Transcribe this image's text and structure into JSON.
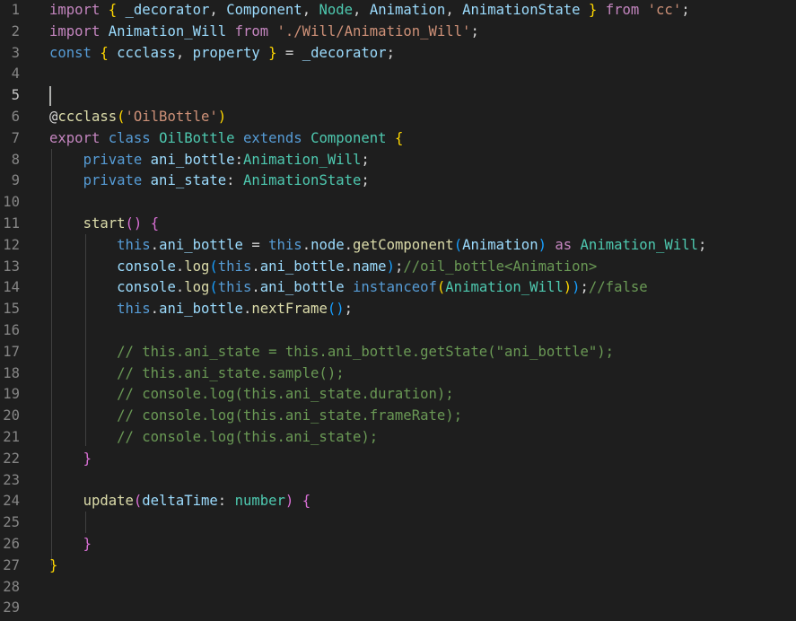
{
  "editor": {
    "active_line": 5,
    "colors": {
      "background": "#1e1e1e",
      "line_number": "#858585",
      "line_number_active": "#c6c6c6",
      "keyword_control": "#c586c0",
      "keyword_storage": "#569cd6",
      "variable": "#9cdcfe",
      "type": "#4ec9b0",
      "function": "#dcdcaa",
      "string": "#ce9178",
      "comment": "#6a9955",
      "punctuation": "#d4d4d4",
      "bracket_1": "#ffd700",
      "bracket_2": "#da70d6",
      "bracket_3": "#179fff"
    },
    "lines": [
      {
        "n": "1",
        "tokens": [
          [
            "import",
            "kw"
          ],
          [
            " ",
            "p"
          ],
          [
            "{",
            "b1"
          ],
          [
            " _decorator",
            "v"
          ],
          [
            ", ",
            "p"
          ],
          [
            "Component",
            "v"
          ],
          [
            ", ",
            "p"
          ],
          [
            "Node",
            "t"
          ],
          [
            ", ",
            "p"
          ],
          [
            "Animation",
            "v"
          ],
          [
            ", ",
            "p"
          ],
          [
            "AnimationState",
            "v"
          ],
          [
            " ",
            "p"
          ],
          [
            "}",
            "b1"
          ],
          [
            " ",
            "p"
          ],
          [
            "from",
            "kw"
          ],
          [
            " ",
            "p"
          ],
          [
            "'cc'",
            "s"
          ],
          [
            ";",
            "p"
          ]
        ]
      },
      {
        "n": "2",
        "tokens": [
          [
            "import",
            "kw"
          ],
          [
            " ",
            "p"
          ],
          [
            "Animation_Will",
            "v"
          ],
          [
            " ",
            "p"
          ],
          [
            "from",
            "kw"
          ],
          [
            " ",
            "p"
          ],
          [
            "'./Will/Animation_Will'",
            "s"
          ],
          [
            ";",
            "p"
          ]
        ]
      },
      {
        "n": "3",
        "tokens": [
          [
            "const",
            "st"
          ],
          [
            " ",
            "p"
          ],
          [
            "{",
            "b1"
          ],
          [
            " ccclass",
            "v"
          ],
          [
            ", ",
            "p"
          ],
          [
            "property",
            "v"
          ],
          [
            " ",
            "p"
          ],
          [
            "}",
            "b1"
          ],
          [
            " = ",
            "p"
          ],
          [
            "_decorator",
            "v"
          ],
          [
            ";",
            "p"
          ]
        ]
      },
      {
        "n": "4",
        "tokens": []
      },
      {
        "n": "5",
        "tokens": []
      },
      {
        "n": "6",
        "tokens": [
          [
            "@",
            "p"
          ],
          [
            "ccclass",
            "f"
          ],
          [
            "(",
            "b1"
          ],
          [
            "'OilBottle'",
            "s"
          ],
          [
            ")",
            "b1"
          ]
        ]
      },
      {
        "n": "7",
        "tokens": [
          [
            "export",
            "kw"
          ],
          [
            " ",
            "p"
          ],
          [
            "class",
            "st"
          ],
          [
            " ",
            "p"
          ],
          [
            "OilBottle",
            "t"
          ],
          [
            " ",
            "p"
          ],
          [
            "extends",
            "st"
          ],
          [
            " ",
            "p"
          ],
          [
            "Component",
            "t"
          ],
          [
            " ",
            "p"
          ],
          [
            "{",
            "b1"
          ]
        ]
      },
      {
        "n": "8",
        "tokens": [
          [
            "    ",
            "p"
          ],
          [
            "private",
            "st"
          ],
          [
            " ",
            "p"
          ],
          [
            "ani_bottle",
            "v"
          ],
          [
            ":",
            "p"
          ],
          [
            "Animation_Will",
            "t"
          ],
          [
            ";",
            "p"
          ]
        ]
      },
      {
        "n": "9",
        "tokens": [
          [
            "    ",
            "p"
          ],
          [
            "private",
            "st"
          ],
          [
            " ",
            "p"
          ],
          [
            "ani_state",
            "v"
          ],
          [
            ": ",
            "p"
          ],
          [
            "AnimationState",
            "t"
          ],
          [
            ";",
            "p"
          ]
        ]
      },
      {
        "n": "10",
        "tokens": []
      },
      {
        "n": "11",
        "tokens": [
          [
            "    ",
            "p"
          ],
          [
            "start",
            "f"
          ],
          [
            "()",
            "b2"
          ],
          [
            " ",
            "p"
          ],
          [
            "{",
            "b2"
          ]
        ]
      },
      {
        "n": "12",
        "tokens": [
          [
            "        ",
            "p"
          ],
          [
            "this",
            "st"
          ],
          [
            ".",
            "p"
          ],
          [
            "ani_bottle",
            "v"
          ],
          [
            " = ",
            "p"
          ],
          [
            "this",
            "st"
          ],
          [
            ".",
            "p"
          ],
          [
            "node",
            "v"
          ],
          [
            ".",
            "p"
          ],
          [
            "getComponent",
            "f"
          ],
          [
            "(",
            "b3"
          ],
          [
            "Animation",
            "v"
          ],
          [
            ")",
            "b3"
          ],
          [
            " ",
            "p"
          ],
          [
            "as",
            "kw"
          ],
          [
            " ",
            "p"
          ],
          [
            "Animation_Will",
            "t"
          ],
          [
            ";",
            "p"
          ]
        ]
      },
      {
        "n": "13",
        "tokens": [
          [
            "        ",
            "p"
          ],
          [
            "console",
            "v"
          ],
          [
            ".",
            "p"
          ],
          [
            "log",
            "f"
          ],
          [
            "(",
            "b3"
          ],
          [
            "this",
            "st"
          ],
          [
            ".",
            "p"
          ],
          [
            "ani_bottle",
            "v"
          ],
          [
            ".",
            "p"
          ],
          [
            "name",
            "v"
          ],
          [
            ")",
            "b3"
          ],
          [
            ";",
            "p"
          ],
          [
            "//oil_bottle<Animation>",
            "c"
          ]
        ]
      },
      {
        "n": "14",
        "tokens": [
          [
            "        ",
            "p"
          ],
          [
            "console",
            "v"
          ],
          [
            ".",
            "p"
          ],
          [
            "log",
            "f"
          ],
          [
            "(",
            "b3"
          ],
          [
            "this",
            "st"
          ],
          [
            ".",
            "p"
          ],
          [
            "ani_bottle",
            "v"
          ],
          [
            " ",
            "p"
          ],
          [
            "instanceof",
            "st"
          ],
          [
            "(",
            "b1"
          ],
          [
            "Animation_Will",
            "t"
          ],
          [
            ")",
            "b1"
          ],
          [
            ")",
            "b3"
          ],
          [
            ";",
            "p"
          ],
          [
            "//false",
            "c"
          ]
        ]
      },
      {
        "n": "15",
        "tokens": [
          [
            "        ",
            "p"
          ],
          [
            "this",
            "st"
          ],
          [
            ".",
            "p"
          ],
          [
            "ani_bottle",
            "v"
          ],
          [
            ".",
            "p"
          ],
          [
            "nextFrame",
            "f"
          ],
          [
            "()",
            "b3"
          ],
          [
            ";",
            "p"
          ]
        ]
      },
      {
        "n": "16",
        "tokens": []
      },
      {
        "n": "17",
        "tokens": [
          [
            "        ",
            "p"
          ],
          [
            "// this.ani_state = this.ani_bottle.getState(\"ani_bottle\");",
            "c"
          ]
        ]
      },
      {
        "n": "18",
        "tokens": [
          [
            "        ",
            "p"
          ],
          [
            "// this.ani_state.sample();",
            "c"
          ]
        ]
      },
      {
        "n": "19",
        "tokens": [
          [
            "        ",
            "p"
          ],
          [
            "// console.log(this.ani_state.duration);",
            "c"
          ]
        ]
      },
      {
        "n": "20",
        "tokens": [
          [
            "        ",
            "p"
          ],
          [
            "// console.log(this.ani_state.frameRate);",
            "c"
          ]
        ]
      },
      {
        "n": "21",
        "tokens": [
          [
            "        ",
            "p"
          ],
          [
            "// console.log(this.ani_state);",
            "c"
          ]
        ]
      },
      {
        "n": "22",
        "tokens": [
          [
            "    ",
            "p"
          ],
          [
            "}",
            "b2"
          ]
        ]
      },
      {
        "n": "23",
        "tokens": []
      },
      {
        "n": "24",
        "tokens": [
          [
            "    ",
            "p"
          ],
          [
            "update",
            "f"
          ],
          [
            "(",
            "b2"
          ],
          [
            "deltaTime",
            "v"
          ],
          [
            ": ",
            "p"
          ],
          [
            "number",
            "t"
          ],
          [
            ")",
            "b2"
          ],
          [
            " ",
            "p"
          ],
          [
            "{",
            "b2"
          ]
        ]
      },
      {
        "n": "25",
        "tokens": []
      },
      {
        "n": "26",
        "tokens": [
          [
            "    ",
            "p"
          ],
          [
            "}",
            "b2"
          ]
        ]
      },
      {
        "n": "27",
        "tokens": [
          [
            "}",
            "b1"
          ]
        ]
      },
      {
        "n": "28",
        "tokens": []
      },
      {
        "n": "29",
        "tokens": []
      }
    ]
  }
}
